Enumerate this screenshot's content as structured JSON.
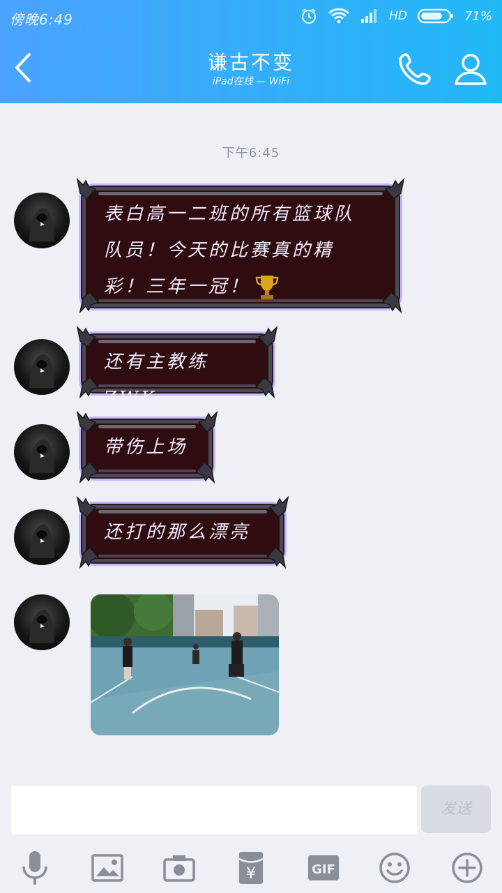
{
  "status_bar": {
    "time": "傍晚6:49",
    "network": "HD",
    "battery": "71%"
  },
  "header": {
    "title": "谦古不变",
    "subtitle": "iPad在线 — WiFi"
  },
  "chat": {
    "timestamp": "下午6:45",
    "messages": [
      {
        "line1": "表白高一二班的所有篮球队",
        "line2": "队员！今天的比赛真的精",
        "line3": "彩！三年一冠！"
      },
      {
        "text": "还有主教练ZWK"
      },
      {
        "text": "带伤上场"
      },
      {
        "text": "还打的那么漂亮"
      }
    ]
  },
  "composer": {
    "send_label": "发送"
  },
  "icons": [
    "back-icon",
    "phone-icon",
    "profile-icon",
    "voice-icon",
    "picture-icon",
    "camera-icon",
    "red-packet-icon",
    "gif-icon",
    "emoji-icon",
    "plus-icon"
  ],
  "colors": {
    "header_start": "#4aa3ff",
    "header_end": "#22b8f6",
    "bubble_bg": "#2e0c0f",
    "bubble_glow": "#c8b6ff"
  }
}
